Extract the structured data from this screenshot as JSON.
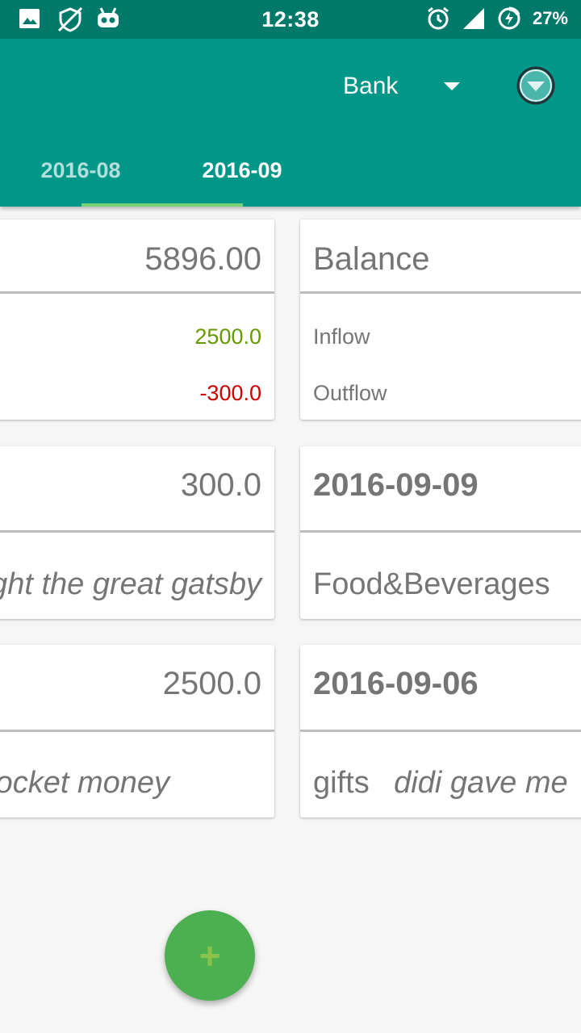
{
  "status_bar": {
    "time": "12:38",
    "battery_pct": "27%",
    "left_icons": [
      "image-icon",
      "vpn-blocked-icon",
      "android-icon"
    ],
    "right_icons": [
      "alarm-icon",
      "signal-icon",
      "battery-charging-icon"
    ]
  },
  "appbar": {
    "account": "Bank",
    "colors": {
      "primary": "#009688",
      "status": "#00796b",
      "accent": "#4caf50"
    }
  },
  "tabs": [
    {
      "label": "2016-08",
      "active": false
    },
    {
      "label": "2016-09",
      "active": true
    }
  ],
  "summary": {
    "balance_value": "5896.00",
    "balance_label": "Balance",
    "inflow_value": "2500.0",
    "inflow_label": "Inflow",
    "outflow_value": "-300.0",
    "outflow_label": "Outflow",
    "inflow_color": "#669900",
    "outflow_color": "#cc0000"
  },
  "transactions": [
    {
      "amount": "300.0",
      "date": "2016-09-09",
      "note": "bought the great gatsby",
      "category": "Food&Beverages"
    },
    {
      "amount": "2500.0",
      "date": "2016-09-06",
      "note": "pocket money",
      "category": "gifts",
      "description": "didi gave me"
    }
  ],
  "fab": {
    "label": "+"
  }
}
